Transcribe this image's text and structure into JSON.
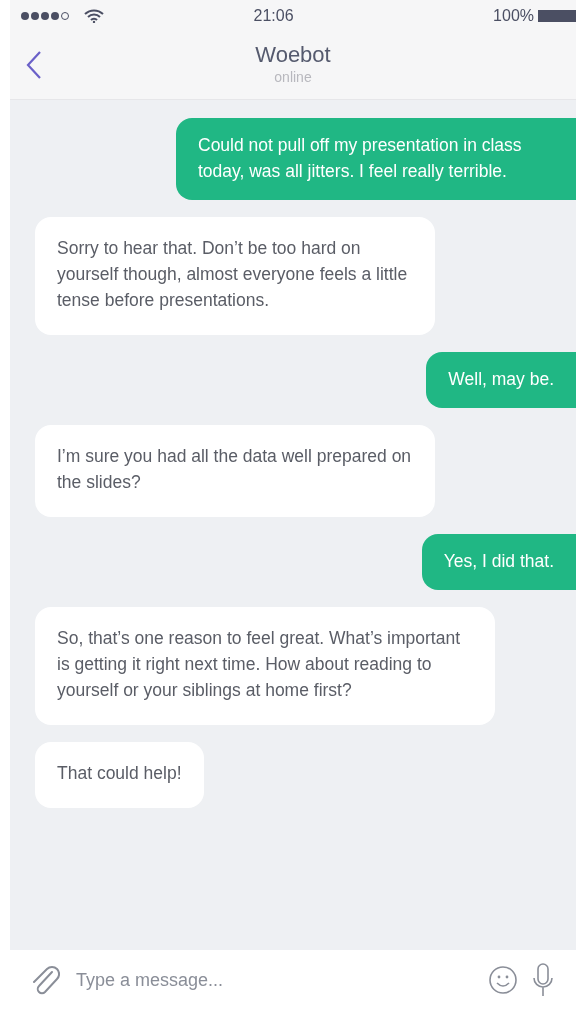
{
  "status_bar": {
    "time": "21:06",
    "battery": "100%"
  },
  "header": {
    "title": "Woebot",
    "subtitle": "online"
  },
  "messages": [
    {
      "kind": "user",
      "text": "Could not pull off my presentation in class today, was all jitters. I feel really terrible."
    },
    {
      "kind": "bot",
      "text": "Sorry to hear that. Don’t be too hard on yourself though, almost everyone feels a little tense before presentations."
    },
    {
      "kind": "user",
      "text": "Well, may be."
    },
    {
      "kind": "bot",
      "text": "I’m sure you had all the data well prepared on the slides?"
    },
    {
      "kind": "user",
      "text": "Yes, I did that."
    },
    {
      "kind": "bot",
      "text": "So, that’s one reason to feel great. What’s important is getting it right next time. How about reading to yourself or your siblings at home first?"
    },
    {
      "kind": "bot",
      "text": "That could help!"
    }
  ],
  "composer": {
    "placeholder": "Type a message..."
  }
}
